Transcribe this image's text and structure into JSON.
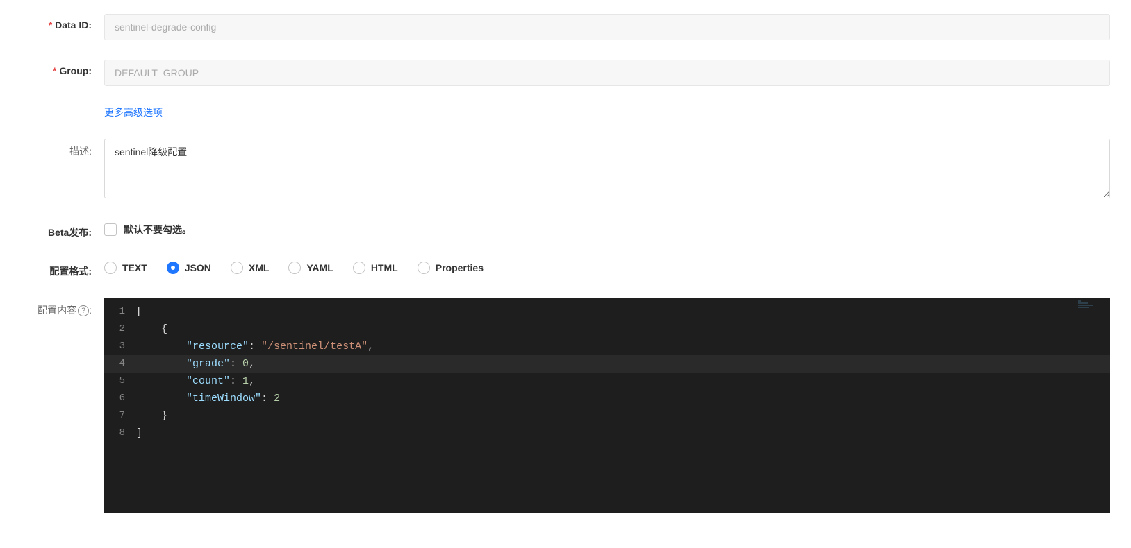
{
  "form": {
    "data_id": {
      "label": "Data ID:",
      "value": "sentinel-degrade-config"
    },
    "group": {
      "label": "Group:",
      "value": "DEFAULT_GROUP"
    },
    "more_link": "更多高级选项",
    "desc": {
      "label": "描述:",
      "value": "sentinel降级配置"
    },
    "beta": {
      "label": "Beta发布:",
      "hint": "默认不要勾选。",
      "checked": false
    },
    "format": {
      "label": "配置格式:",
      "options": [
        "TEXT",
        "JSON",
        "XML",
        "YAML",
        "HTML",
        "Properties"
      ],
      "selected": "JSON"
    },
    "content": {
      "label": "配置内容",
      "help": "?"
    }
  },
  "editor": {
    "active_line": 4,
    "lines": [
      {
        "n": 1,
        "tokens": [
          [
            "brace",
            "["
          ]
        ]
      },
      {
        "n": 2,
        "tokens": [
          [
            "ws",
            "    "
          ],
          [
            "brace",
            "{"
          ]
        ]
      },
      {
        "n": 3,
        "tokens": [
          [
            "ws",
            "        "
          ],
          [
            "key",
            "\"resource\""
          ],
          [
            "punc",
            ": "
          ],
          [
            "str",
            "\"/sentinel/testA\""
          ],
          [
            "punc",
            ","
          ]
        ]
      },
      {
        "n": 4,
        "tokens": [
          [
            "ws",
            "        "
          ],
          [
            "key",
            "\"grade\""
          ],
          [
            "punc",
            ": "
          ],
          [
            "num",
            "0"
          ],
          [
            "punc",
            ","
          ]
        ]
      },
      {
        "n": 5,
        "tokens": [
          [
            "ws",
            "        "
          ],
          [
            "key",
            "\"count\""
          ],
          [
            "punc",
            ": "
          ],
          [
            "num",
            "1"
          ],
          [
            "punc",
            ","
          ]
        ]
      },
      {
        "n": 6,
        "tokens": [
          [
            "ws",
            "        "
          ],
          [
            "key",
            "\"timeWindow\""
          ],
          [
            "punc",
            ": "
          ],
          [
            "num",
            "2"
          ]
        ]
      },
      {
        "n": 7,
        "tokens": [
          [
            "ws",
            "    "
          ],
          [
            "brace",
            "}"
          ]
        ]
      },
      {
        "n": 8,
        "tokens": [
          [
            "brace",
            "]"
          ]
        ]
      }
    ]
  }
}
